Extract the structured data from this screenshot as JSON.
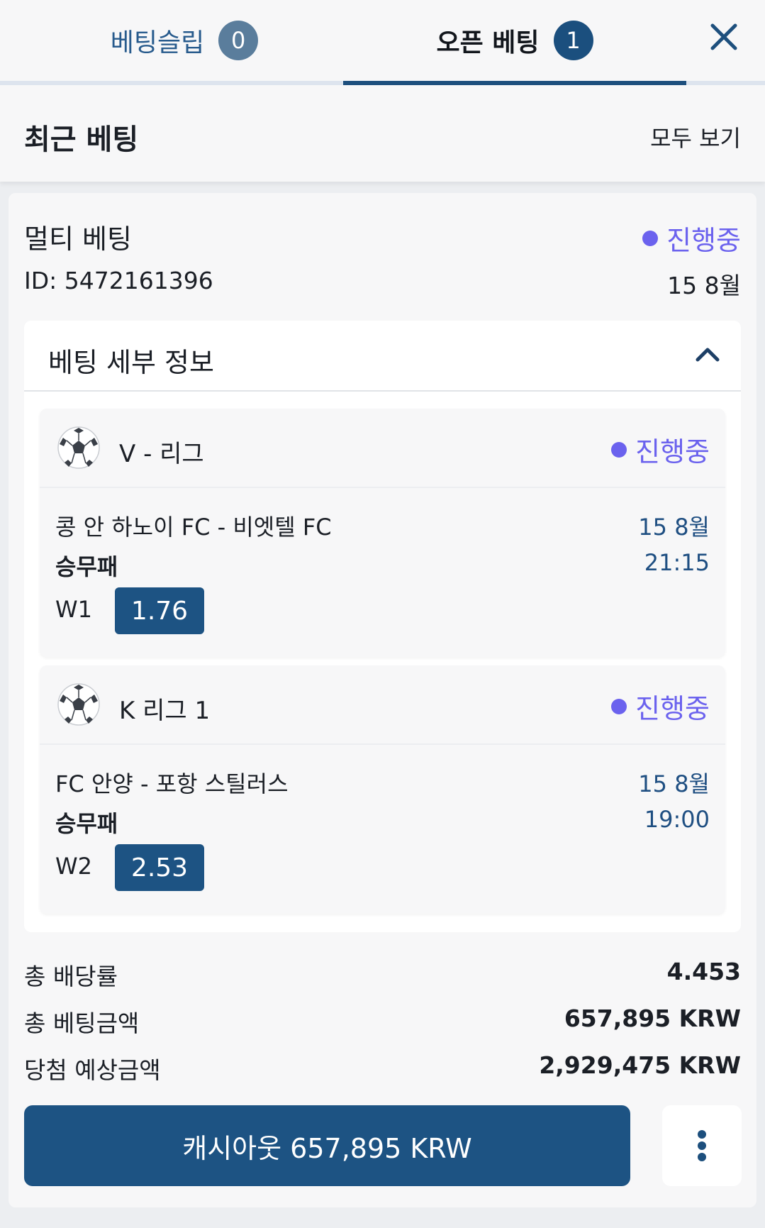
{
  "tabs": {
    "betslip_label": "베팅슬립",
    "betslip_count": "0",
    "open_label": "오픈 베팅",
    "open_count": "1"
  },
  "recent": {
    "title": "최근 베팅",
    "view_all": "모두 보기"
  },
  "bet": {
    "type": "멀티 베팅",
    "status": "진행중",
    "id": "ID: 5472161396",
    "date": "15 8월",
    "details_title": "베팅 세부 정보",
    "events": [
      {
        "league": "V - 리그",
        "status": "진행중",
        "match": "콩 안 하노이 FC - 비엣텔 FC",
        "date": "15 8월",
        "market": "승무패",
        "time": "21:15",
        "pick": "W1",
        "odds": "1.76"
      },
      {
        "league": "K 리그 1",
        "status": "진행중",
        "match": "FC 안양 - 포항 스틸러스",
        "date": "15 8월",
        "market": "승무패",
        "time": "19:00",
        "pick": "W2",
        "odds": "2.53"
      }
    ],
    "summary": {
      "total_odds_label": "총 배당률",
      "total_odds_value": "4.453",
      "total_stake_label": "총 베팅금액",
      "total_stake_value": "657,895 KRW",
      "potential_win_label": "당첨 예상금액",
      "potential_win_value": "2,929,475 KRW"
    },
    "cashout_label": "캐시아웃 657,895 KRW"
  },
  "colors": {
    "accent": "#1d5383",
    "status": "#6b62ee",
    "date_text": "#1f4f82"
  },
  "icons": {
    "close": "close-icon",
    "chevron": "chevron-up-icon",
    "sport": "soccer-ball-icon",
    "more": "more-vertical-icon"
  }
}
